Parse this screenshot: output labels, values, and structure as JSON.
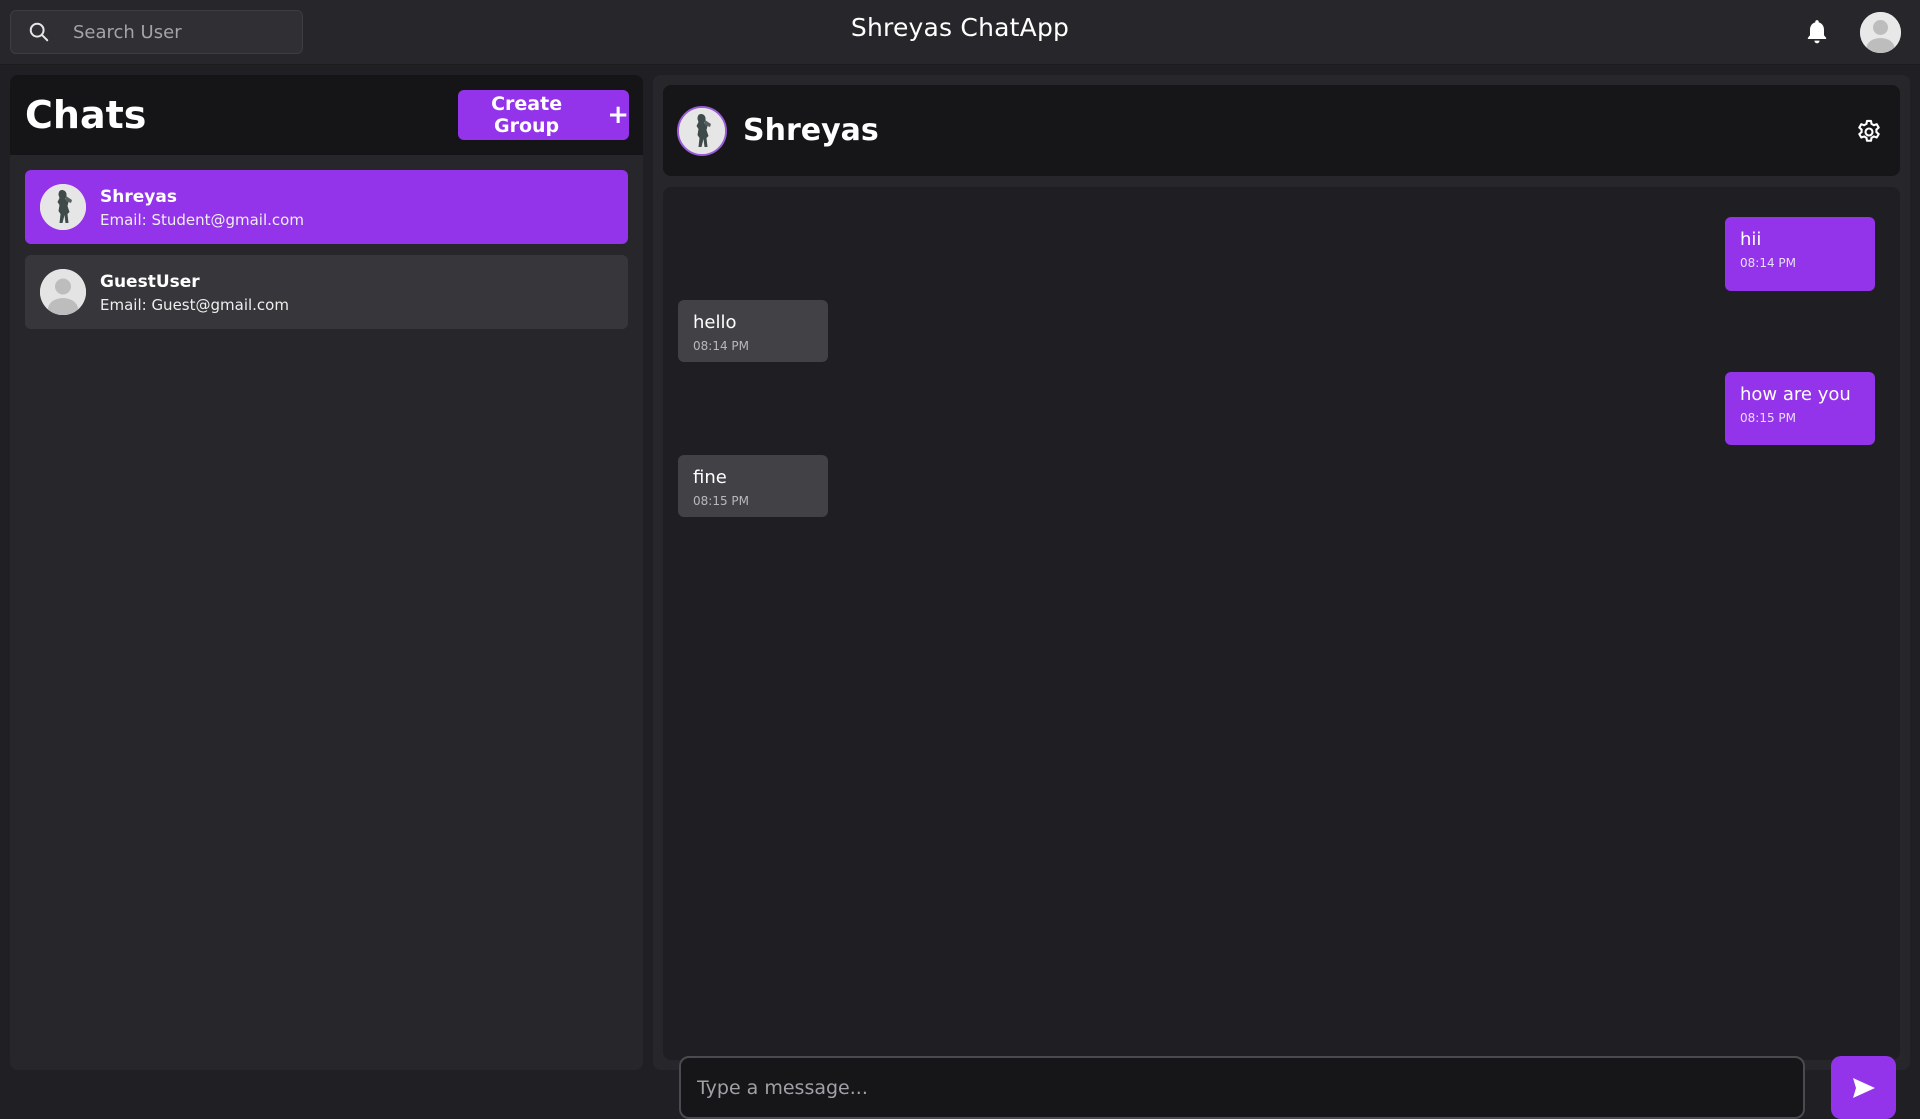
{
  "app": {
    "title": "Shreyas ChatApp",
    "accent_color": "#9333ea"
  },
  "topbar": {
    "search_placeholder": "Search User",
    "search_icon": "search-icon",
    "notification_icon": "bell-icon",
    "profile_icon": "user-avatar-icon"
  },
  "sidebar": {
    "title": "Chats",
    "create_group_label": "Create Group",
    "create_group_icon": "+",
    "chats": [
      {
        "name": "Shreyas",
        "email": "Email: Student@gmail.com",
        "active": true,
        "avatar": "character-figure-avatar"
      },
      {
        "name": "GuestUser",
        "email": "Email: Guest@gmail.com",
        "active": false,
        "avatar": "default-user-avatar"
      }
    ]
  },
  "conversation": {
    "name": "Shreyas",
    "settings_icon": "gear-icon",
    "messages": [
      {
        "text": "hii",
        "time": "08:14 PM",
        "direction": "sent"
      },
      {
        "text": "hello",
        "time": "08:14 PM",
        "direction": "received"
      },
      {
        "text": "how are you",
        "time": "08:15 PM",
        "direction": "sent"
      },
      {
        "text": "fine",
        "time": "08:15 PM",
        "direction": "received"
      }
    ],
    "composer_placeholder": "Type a message...",
    "send_icon": "send-icon"
  }
}
